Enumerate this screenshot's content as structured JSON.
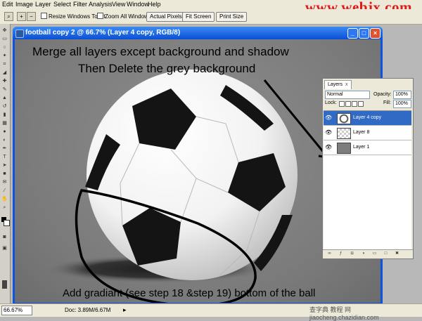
{
  "menu": {
    "items": [
      "Edit",
      "Image",
      "Layer",
      "Select",
      "Filter",
      "Analysis",
      "View",
      "Window",
      "Help"
    ]
  },
  "watermark": "www.webjx.com",
  "options_bar": {
    "resize_windows": "Resize Windows To Fit",
    "zoom_all": "Zoom All Windows",
    "actual_pixels": "Actual Pixels",
    "fit_screen": "Fit Screen",
    "print_size": "Print Size"
  },
  "document": {
    "title": "football copy 2 @ 66.7% (Layer 4 copy, RGB/8)"
  },
  "annotations": {
    "line1": "Merge all layers except background and shadow",
    "line2": "Then Delete the grey background",
    "bottom": "Add gradiant (see step 18 &step 19) bottom of the ball"
  },
  "layers_panel": {
    "tab": "Layers",
    "tab_close": "x",
    "blend_mode": "Normal",
    "opacity_label": "Opacity:",
    "opacity_value": "100%",
    "lock_label": "Lock:",
    "fill_label": "Fill:",
    "fill_value": "100%",
    "layers": [
      {
        "name": "Layer 4 copy",
        "thumb": "ball",
        "selected": true
      },
      {
        "name": "Layer 8",
        "thumb": "checker",
        "selected": false
      },
      {
        "name": "Layer 1",
        "thumb": "grey",
        "selected": false
      }
    ]
  },
  "status_bar": {
    "zoom": "66.67%",
    "doc": "Doc: 3.89M/6.67M"
  },
  "footer_watermark": "查字典 教程 网 jiaocheng.chazidian.com",
  "colors": {
    "watermark": "#e01818",
    "selected_layer": "#316ac5",
    "title_bar": "#0a4fd6",
    "canvas": "#7a7a7a"
  }
}
